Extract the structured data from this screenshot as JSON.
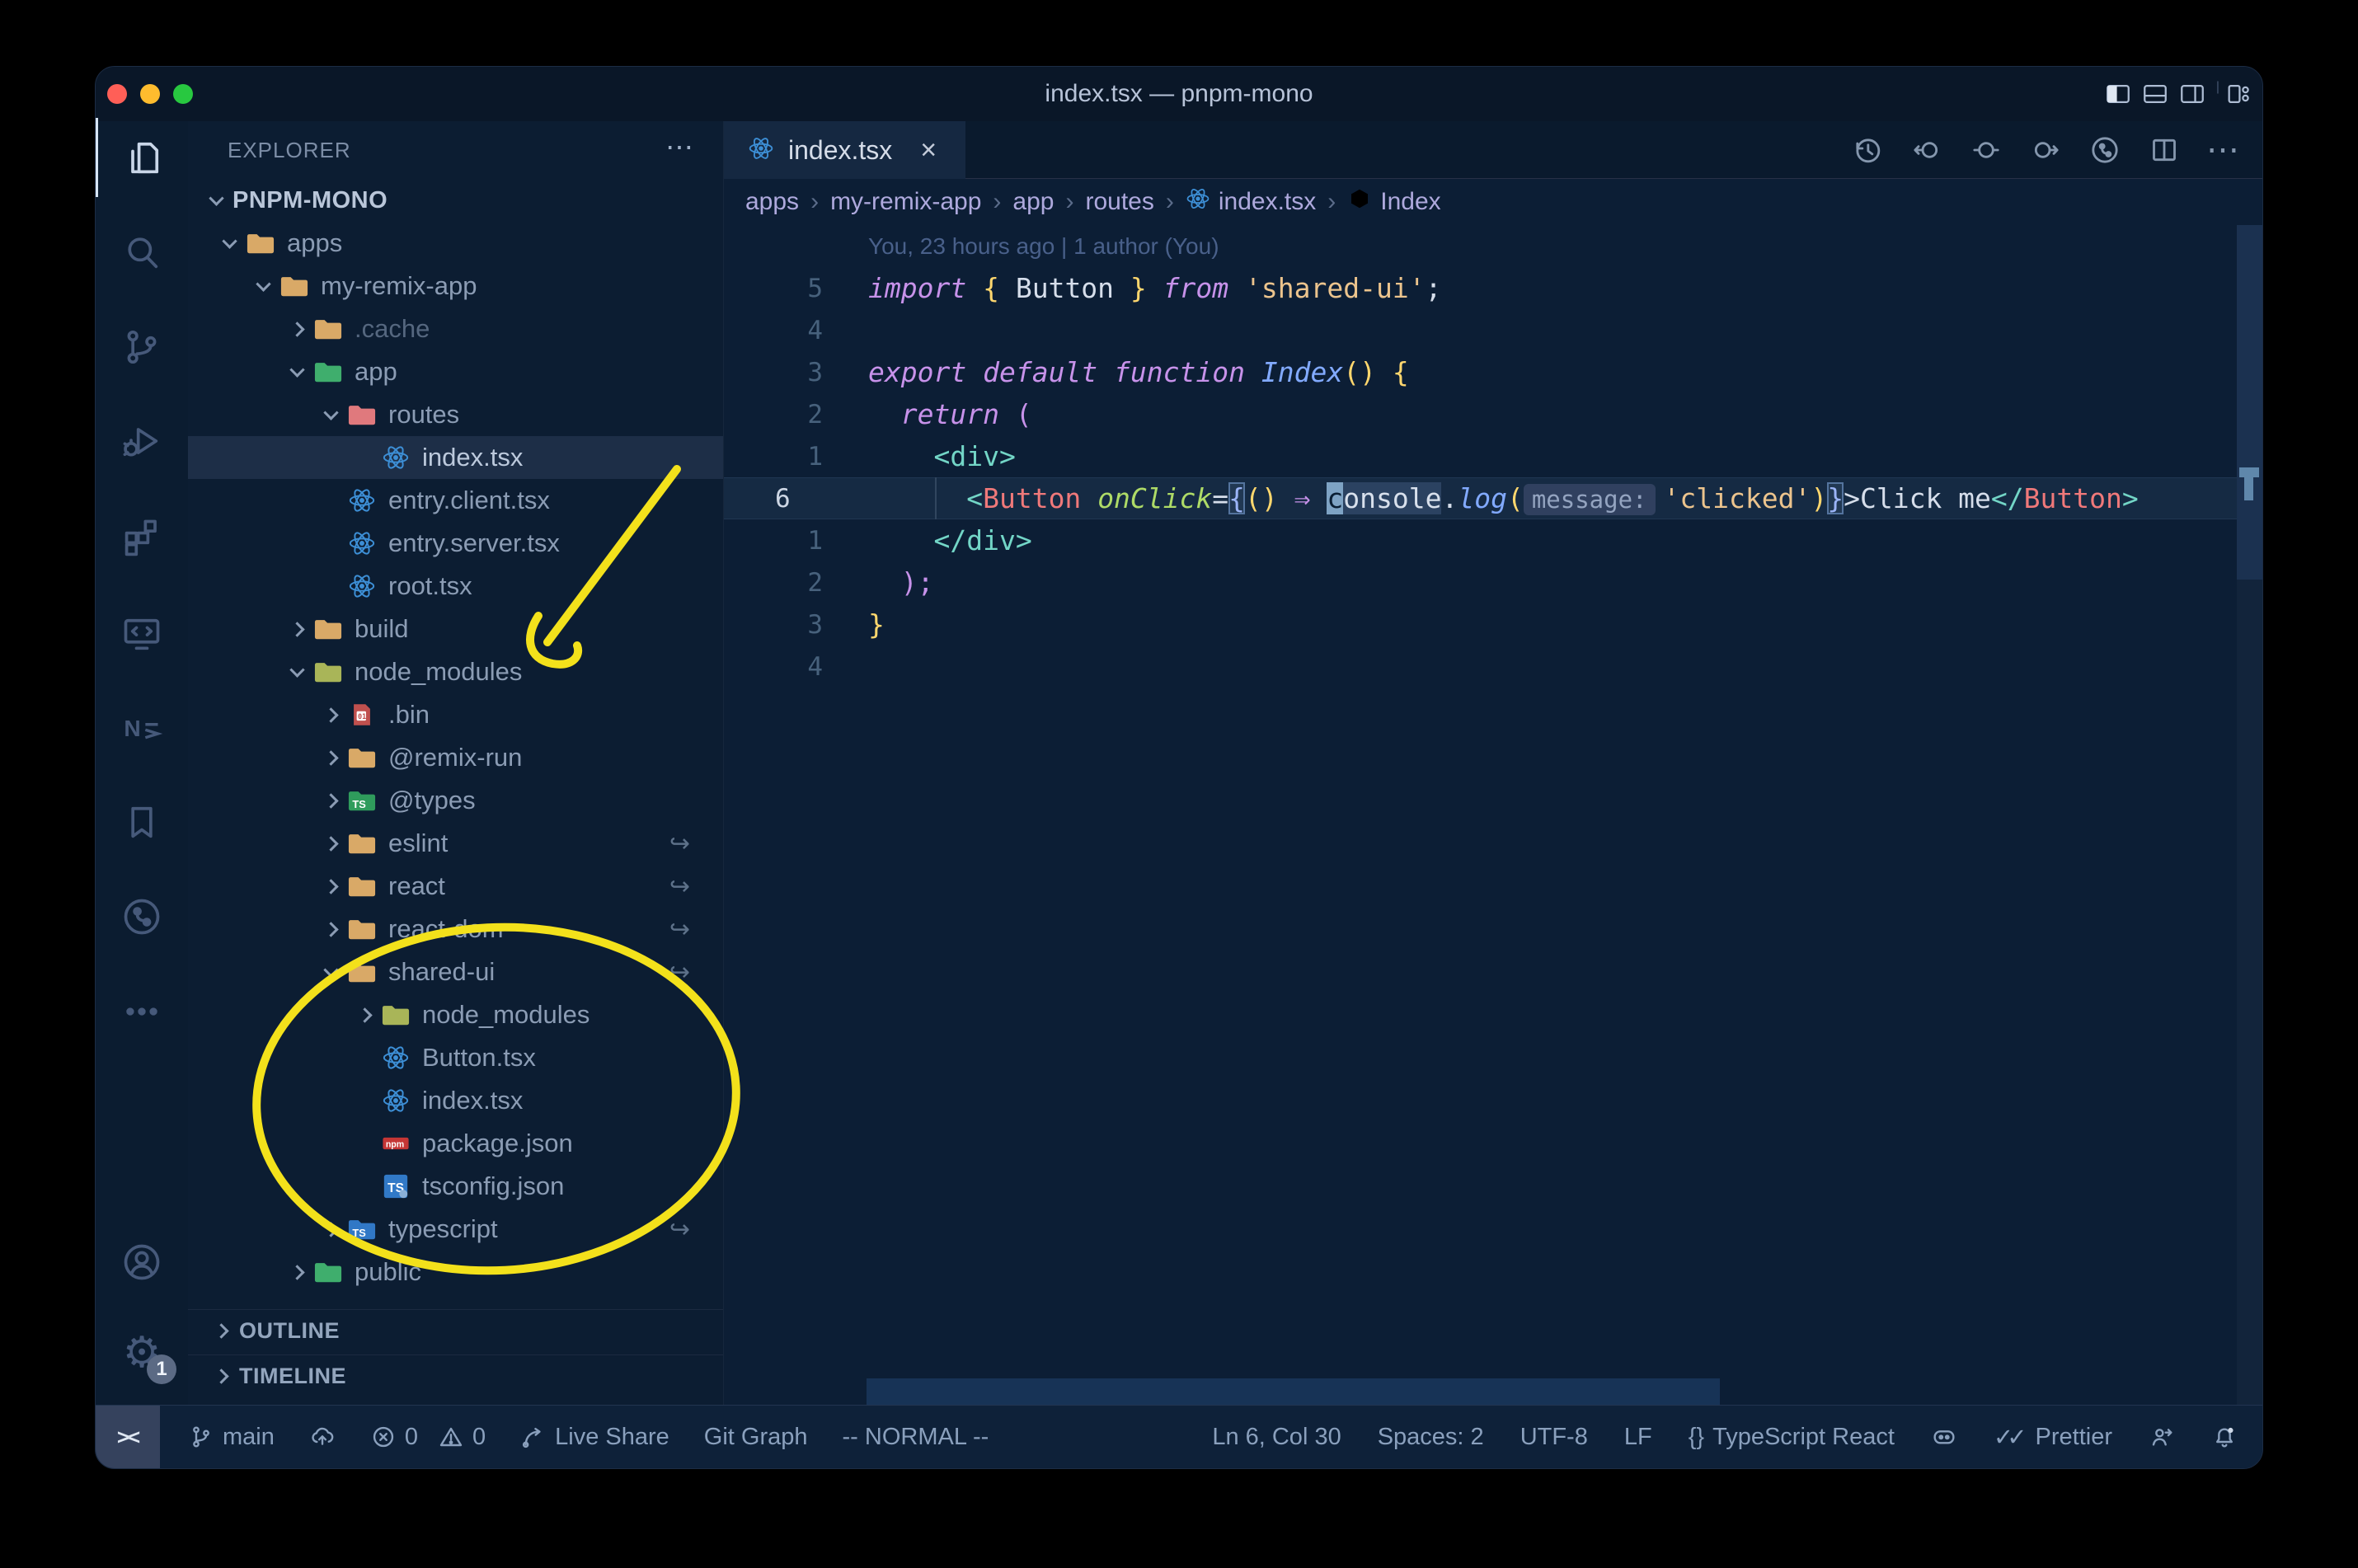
{
  "window": {
    "title": "index.tsx — pnpm-mono"
  },
  "colors": {
    "annotation_yellow": "#f3e11b",
    "editor_bg": "#0c1e35",
    "accent_blue": "#3d8fd6",
    "selection_bg": "#1d2e47"
  },
  "activity_bar": {
    "items": [
      {
        "icon": "files-icon",
        "active": true
      },
      {
        "icon": "search-icon"
      },
      {
        "icon": "source-control-icon"
      },
      {
        "icon": "run-debug-icon"
      },
      {
        "icon": "extensions-icon"
      },
      {
        "icon": "remote-explorer-icon"
      },
      {
        "icon": "nx-console-icon"
      },
      {
        "icon": "bookmarks-icon"
      },
      {
        "icon": "git-graph-icon"
      },
      {
        "icon": "more-icon"
      }
    ],
    "bottom_items": [
      {
        "icon": "account-icon"
      },
      {
        "icon": "settings-gear-icon",
        "badge": "1"
      }
    ]
  },
  "sidebar": {
    "header": "EXPLORER",
    "more": "⋯",
    "sections": [
      "OUTLINE",
      "TIMELINE"
    ],
    "tree": [
      {
        "label": "PNPM-MONO",
        "level": 0,
        "chevron": "down",
        "icon": "none",
        "root": true
      },
      {
        "label": "apps",
        "level": 1,
        "chevron": "down",
        "icon": "folder-tan"
      },
      {
        "label": "my-remix-app",
        "level": 2,
        "chevron": "down",
        "icon": "folder-tan"
      },
      {
        "label": ".cache",
        "level": 3,
        "chevron": "right",
        "icon": "folder-tan",
        "dim": true
      },
      {
        "label": "app",
        "level": 3,
        "chevron": "down",
        "icon": "folder-green"
      },
      {
        "label": "routes",
        "level": 4,
        "chevron": "down",
        "icon": "folder-routes"
      },
      {
        "label": "index.tsx",
        "level": 5,
        "chevron": "none",
        "icon": "react",
        "selected": true
      },
      {
        "label": "entry.client.tsx",
        "level": 4,
        "chevron": "none",
        "icon": "react"
      },
      {
        "label": "entry.server.tsx",
        "level": 4,
        "chevron": "none",
        "icon": "react"
      },
      {
        "label": "root.tsx",
        "level": 4,
        "chevron": "none",
        "icon": "react"
      },
      {
        "label": "build",
        "level": 3,
        "chevron": "right",
        "icon": "folder-build"
      },
      {
        "label": "node_modules",
        "level": 3,
        "chevron": "down",
        "icon": "folder-node"
      },
      {
        "label": ".bin",
        "level": 4,
        "chevron": "right",
        "icon": "bin-file"
      },
      {
        "label": "@remix-run",
        "level": 4,
        "chevron": "right",
        "icon": "folder-tan"
      },
      {
        "label": "@types",
        "level": 4,
        "chevron": "right",
        "icon": "folder-ts-green"
      },
      {
        "label": "eslint",
        "level": 4,
        "chevron": "right",
        "icon": "folder-tan",
        "symlink": true
      },
      {
        "label": "react",
        "level": 4,
        "chevron": "right",
        "icon": "folder-tan",
        "symlink": true
      },
      {
        "label": "react-dom",
        "level": 4,
        "chevron": "right",
        "icon": "folder-tan",
        "symlink": true
      },
      {
        "label": "shared-ui",
        "level": 4,
        "chevron": "down",
        "icon": "folder-tan",
        "symlink": true
      },
      {
        "label": "node_modules",
        "level": 5,
        "chevron": "right",
        "icon": "folder-node"
      },
      {
        "label": "Button.tsx",
        "level": 5,
        "chevron": "none",
        "icon": "react"
      },
      {
        "label": "index.tsx",
        "level": 5,
        "chevron": "none",
        "icon": "react"
      },
      {
        "label": "package.json",
        "level": 5,
        "chevron": "none",
        "icon": "npm-file"
      },
      {
        "label": "tsconfig.json",
        "level": 5,
        "chevron": "none",
        "icon": "ts-config"
      },
      {
        "label": "typescript",
        "level": 4,
        "chevron": "right",
        "icon": "folder-ts-blue",
        "symlink": true
      },
      {
        "label": "public",
        "level": 3,
        "chevron": "right",
        "icon": "folder-public"
      }
    ]
  },
  "tabs": [
    {
      "label": "index.tsx",
      "icon": "react-icon",
      "close": "×"
    }
  ],
  "editor_actions": [
    {
      "icon": "history-icon"
    },
    {
      "icon": "nav-back-icon"
    },
    {
      "icon": "nav-location-icon"
    },
    {
      "icon": "nav-forward-icon"
    },
    {
      "icon": "git-circle-icon"
    },
    {
      "icon": "split-editor-icon"
    },
    {
      "icon": "more-actions-icon",
      "glyph": "⋯"
    }
  ],
  "breadcrumbs": [
    {
      "label": "apps"
    },
    {
      "label": "my-remix-app"
    },
    {
      "label": "app"
    },
    {
      "label": "routes"
    },
    {
      "label": "index.tsx",
      "icon": "react-icon"
    },
    {
      "label": "Index",
      "icon": "symbol-cube-icon"
    }
  ],
  "editor": {
    "blame": "You, 23 hours ago | 1 author (You)",
    "lines": [
      {
        "num": "5",
        "tokens": [
          [
            "import",
            "kw"
          ],
          [
            " ",
            "txt"
          ],
          [
            "{",
            "gold"
          ],
          [
            " Button ",
            "txt"
          ],
          [
            "}",
            "gold"
          ],
          [
            " ",
            "txt"
          ],
          [
            "from",
            "kw"
          ],
          [
            " ",
            "txt"
          ],
          [
            "'shared-ui'",
            "str"
          ],
          [
            ";",
            "txt"
          ]
        ]
      },
      {
        "num": "4",
        "tokens": []
      },
      {
        "num": "3",
        "tokens": [
          [
            "export",
            "kw"
          ],
          [
            " ",
            "txt"
          ],
          [
            "default",
            "kw"
          ],
          [
            " ",
            "txt"
          ],
          [
            "function",
            "kw"
          ],
          [
            " ",
            "txt"
          ],
          [
            "Index",
            "fn"
          ],
          [
            "()",
            "gold"
          ],
          [
            " ",
            "txt"
          ],
          [
            "{",
            "gold"
          ]
        ]
      },
      {
        "num": "2",
        "tokens": [
          [
            "  ",
            "txt"
          ],
          [
            "return",
            "kw"
          ],
          [
            " ",
            "txt"
          ],
          [
            "(",
            "pink"
          ]
        ]
      },
      {
        "num": "1",
        "tokens": [
          [
            "    ",
            "txt"
          ],
          [
            "<div>",
            "tag"
          ]
        ]
      },
      {
        "num": "6",
        "active": true,
        "tokens": [
          [
            "      ",
            "txt"
          ],
          [
            "<",
            "tag"
          ],
          [
            "Button",
            "comp"
          ],
          [
            " ",
            "txt"
          ],
          [
            "onClick",
            "attr"
          ],
          [
            "=",
            "txt"
          ],
          [
            "{",
            "brkt"
          ],
          [
            "()",
            "gold"
          ],
          [
            " ",
            "txt"
          ],
          [
            "⇒",
            "pink"
          ],
          [
            " ",
            "txt"
          ],
          [
            "c",
            "cursor"
          ],
          [
            "onsole",
            "occ"
          ],
          [
            ".",
            "txt"
          ],
          [
            "log",
            "fn"
          ],
          [
            "(",
            "gold"
          ],
          [
            "message:",
            "inlay"
          ],
          [
            "'clicked'",
            "str"
          ],
          [
            ")",
            "gold"
          ],
          [
            "}",
            "brkt"
          ],
          [
            ">",
            "txt"
          ],
          [
            "Click me",
            "txt"
          ],
          [
            "</",
            "tag"
          ],
          [
            "Button",
            "comp"
          ],
          [
            ">",
            "tag"
          ]
        ]
      },
      {
        "num": "1",
        "tokens": [
          [
            "    ",
            "txt"
          ],
          [
            "</div>",
            "tag"
          ]
        ]
      },
      {
        "num": "2",
        "tokens": [
          [
            "  ",
            "txt"
          ],
          [
            ");",
            "pink"
          ]
        ]
      },
      {
        "num": "3",
        "tokens": [
          [
            "}",
            "gold"
          ]
        ]
      },
      {
        "num": "4",
        "tokens": []
      }
    ]
  },
  "status_bar": {
    "left": [
      {
        "icon": "branch-icon",
        "label": "main"
      },
      {
        "icon": "cloud-upload-icon",
        "label": ""
      },
      {
        "icon": "error-icon",
        "label": "0",
        "icon2": "warning-icon",
        "label2": "0"
      },
      {
        "icon": "live-share-icon",
        "label": "Live Share"
      },
      {
        "label": "Git Graph"
      },
      {
        "label": "-- NORMAL --"
      }
    ],
    "remote_glyph": "><",
    "right": [
      {
        "label": "Ln 6, Col 30"
      },
      {
        "label": "Spaces: 2"
      },
      {
        "label": "UTF-8"
      },
      {
        "label": "LF"
      },
      {
        "icon": "brackets-icon",
        "glyph": "{}",
        "label": "TypeScript React"
      },
      {
        "icon": "copilot-icon"
      },
      {
        "icon": "prettier-check-icon",
        "glyph": "✓✓",
        "label": "Prettier"
      },
      {
        "icon": "person-share-icon"
      },
      {
        "icon": "bell-dot-icon"
      }
    ]
  }
}
